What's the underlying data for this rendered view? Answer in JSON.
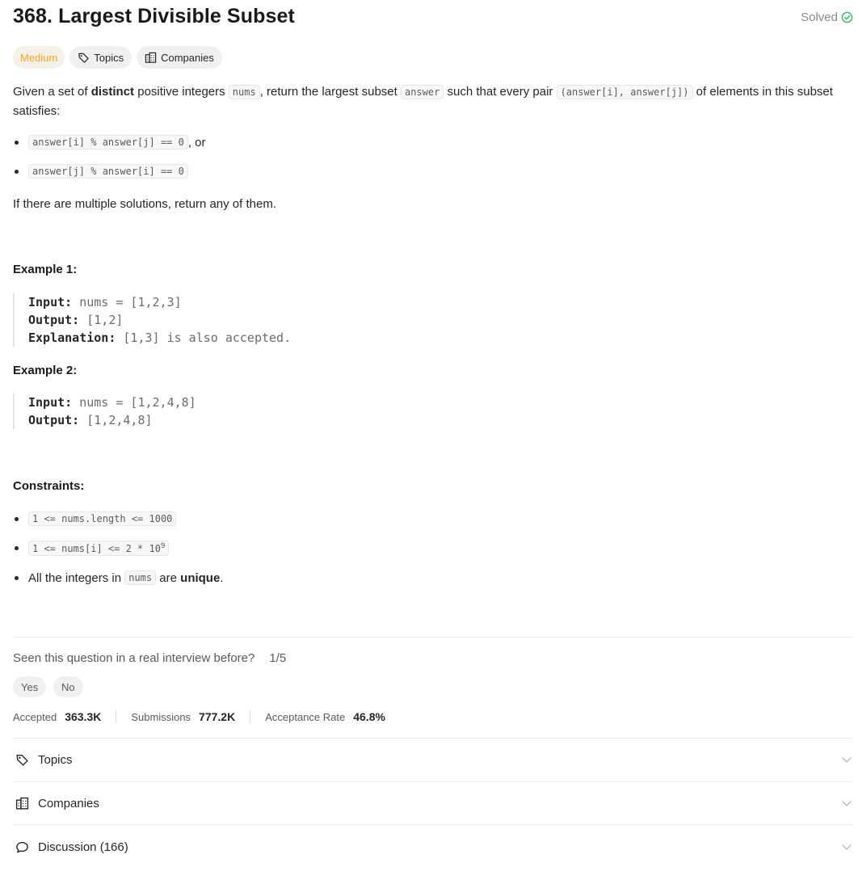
{
  "problem": {
    "title": "368. Largest Divisible Subset",
    "status": "Solved",
    "difficulty": "Medium",
    "tag_topics": "Topics",
    "tag_companies": "Companies"
  },
  "description": {
    "p1_a": "Given a set of ",
    "p1_b": "distinct",
    "p1_c": " positive integers ",
    "p1_code1": "nums",
    "p1_d": ", return the largest subset ",
    "p1_code2": "answer",
    "p1_e": " such that every pair ",
    "p1_code3": "(answer[i], answer[j])",
    "p1_f": " of elements in this subset satisfies:",
    "bullet1_code": "answer[i] % answer[j] == 0",
    "bullet1_suffix": ", or",
    "bullet2_code": "answer[j] % answer[i] == 0",
    "p2": "If there are multiple solutions, return any of them."
  },
  "examples": [
    {
      "heading": "Example 1:",
      "input_label": "Input:",
      "input_value": " nums = [1,2,3]",
      "output_label": "Output:",
      "output_value": " [1,2]",
      "explanation_label": "Explanation:",
      "explanation_value": " [1,3] is also accepted."
    },
    {
      "heading": "Example 2:",
      "input_label": "Input:",
      "input_value": " nums = [1,2,4,8]",
      "output_label": "Output:",
      "output_value": " [1,2,4,8]"
    }
  ],
  "constraints": {
    "heading": "Constraints:",
    "c1": "1 <= nums.length <= 1000",
    "c2_base": "1 <= nums[i] <= 2 * 10",
    "c2_exp": "9",
    "c3_a": "All the integers in ",
    "c3_code": "nums",
    "c3_b": " are ",
    "c3_bold": "unique",
    "c3_c": "."
  },
  "interview": {
    "question": "Seen this question in a real interview before?",
    "fraction": "1/5",
    "yes": "Yes",
    "no": "No"
  },
  "stats": {
    "accepted_label": "Accepted",
    "accepted_value": "363.3K",
    "submissions_label": "Submissions",
    "submissions_value": "777.2K",
    "rate_label": "Acceptance Rate",
    "rate_value": "46.8%"
  },
  "accordion": {
    "topics": "Topics",
    "companies": "Companies",
    "discussion": "Discussion (166)"
  },
  "colors": {
    "medium": "#f5a623",
    "solved_check": "#2cbb5d"
  }
}
